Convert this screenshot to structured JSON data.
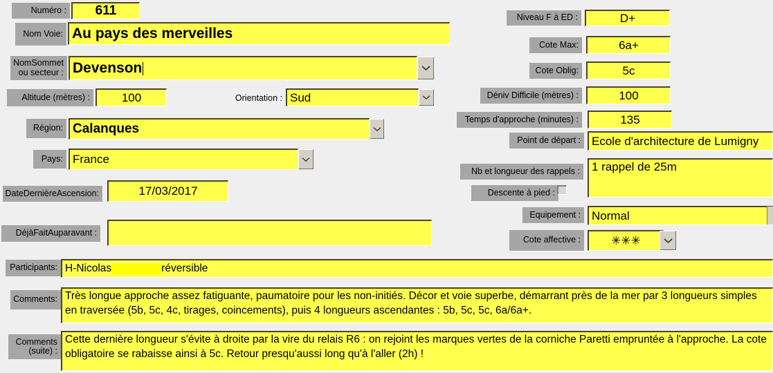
{
  "form": {
    "numero": {
      "label": "Numéro :",
      "value": "611"
    },
    "nom_voie": {
      "label": "Nom Voie:",
      "value": "Au pays des merveilles"
    },
    "nom_sommet": {
      "label_line1": "NomSommet",
      "label_line2": "ou secteur :",
      "value": "Devenson"
    },
    "altitude": {
      "label": "Altitude (mètres) :",
      "value": "100"
    },
    "orientation": {
      "label": "Orientation :",
      "value": "Sud"
    },
    "region": {
      "label": "Région:",
      "value": "Calanques"
    },
    "pays": {
      "label": "Pays:",
      "value": "France"
    },
    "date_derniere_ascension": {
      "label": "DateDernièreAscension:",
      "value": "17/03/2017"
    },
    "deja_fait_auparavant": {
      "label": "DéjàFaitAuparavant :",
      "value": ""
    },
    "niveau": {
      "label": "Niveau F à ED :",
      "value": "D+"
    },
    "cote_max": {
      "label": "Cote Max:",
      "value": "6a+"
    },
    "cote_oblig": {
      "label": "Cote Oblig:",
      "value": "5c"
    },
    "deniv_difficile": {
      "label": "Déniv Difficile (mètres) :",
      "value": "100"
    },
    "temps_approche": {
      "label": "Temps d'approche (minutes) :",
      "value": "135"
    },
    "point_depart": {
      "label": "Point de départ :",
      "value": "Ecole d'architecture de Lumigny"
    },
    "rappels": {
      "label": "Nb et longueur des rappels :",
      "value": "1 rappel de 25m"
    },
    "descente_a_pied": {
      "label": "Descente à pied :",
      "checked": false
    },
    "equipement": {
      "label": "Equipement :",
      "value": "Normal"
    },
    "cote_affective": {
      "label": "Cote affective :",
      "value": "✳✳✳"
    },
    "participants": {
      "label": "Participants:",
      "value_before": "H-Nicolas",
      "value_after": "réversible"
    },
    "comments": {
      "label": "Comments:",
      "value": "Très longue approche assez fatiguante, paumatoire pour les non-initiés. Décor et voie superbe, démarrant près de la mer par 3 longueurs simples en traversée (5b, 5c, 4c, tirages, coincements), puis 4 longueurs ascendantes : 5b, 5c, 5c, 6a/6a+."
    },
    "comments_suite": {
      "label_line1": "Comments",
      "label_line2": "(suite) :",
      "value": "Cette dernière longueur s'évite à droite par la vire du relais R6 : on rejoint les marques vertes de la corniche Paretti empruntée à l'approche. La cote obligatoire se rabaisse ainsi à 5c. Retour presqu'aussi long qu'à l'aller (2h) !"
    }
  },
  "colors": {
    "field_bg": "#ffff4d",
    "label_bg": "#a6a6a6",
    "page_bg": "#efefef",
    "highlight": "#ffff00"
  }
}
